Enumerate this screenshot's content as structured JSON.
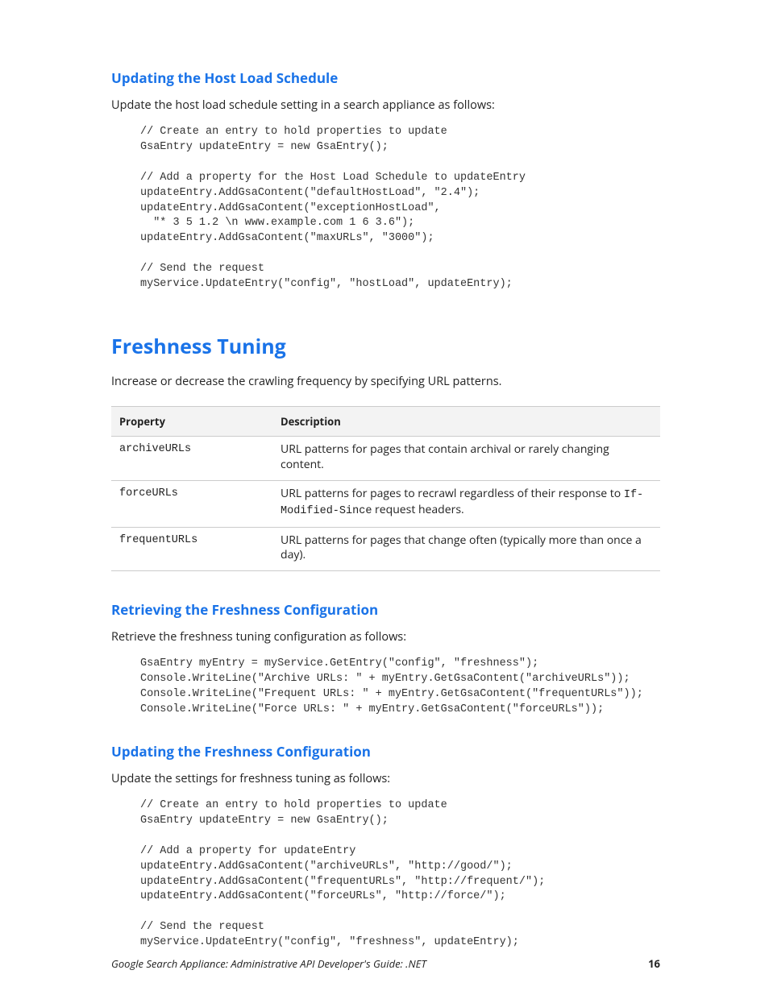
{
  "section1": {
    "heading": "Updating the Host Load Schedule",
    "intro": "Update the host load schedule setting in a search appliance as follows:",
    "code": "// Create an entry to hold properties to update\nGsaEntry updateEntry = new GsaEntry();\n\n// Add a property for the Host Load Schedule to updateEntry\nupdateEntry.AddGsaContent(\"defaultHostLoad\", \"2.4\");\nupdateEntry.AddGsaContent(\"exceptionHostLoad\",\n  \"* 3 5 1.2 \\n www.example.com 1 6 3.6\");\nupdateEntry.AddGsaContent(\"maxURLs\", \"3000\");\n\n// Send the request\nmyService.UpdateEntry(\"config\", \"hostLoad\", updateEntry);"
  },
  "section2": {
    "heading": "Freshness Tuning",
    "intro": "Increase or decrease the crawling frequency by specifying URL patterns.",
    "table": {
      "headers": [
        "Property",
        "Description"
      ],
      "rows": [
        {
          "prop": "archiveURLs",
          "desc_plain": "URL patterns for pages that contain archival or rarely changing content."
        },
        {
          "prop": "forceURLs",
          "desc_prefix": "URL patterns for pages to recrawl regardless of their response to ",
          "desc_code": "If-Modified-Since",
          "desc_suffix": " request headers."
        },
        {
          "prop": "frequentURLs",
          "desc_plain": "URL patterns for pages that change often (typically more than once a day)."
        }
      ]
    }
  },
  "section3": {
    "heading": "Retrieving the Freshness Configuration",
    "intro": "Retrieve the freshness tuning configuration as follows:",
    "code": "GsaEntry myEntry = myService.GetEntry(\"config\", \"freshness\");\nConsole.WriteLine(\"Archive URLs: \" + myEntry.GetGsaContent(\"archiveURLs\"));\nConsole.WriteLine(\"Frequent URLs: \" + myEntry.GetGsaContent(\"frequentURLs\"));\nConsole.WriteLine(\"Force URLs: \" + myEntry.GetGsaContent(\"forceURLs\"));"
  },
  "section4": {
    "heading": "Updating the Freshness Configuration",
    "intro": "Update the settings for freshness tuning as follows:",
    "code": "// Create an entry to hold properties to update\nGsaEntry updateEntry = new GsaEntry();\n\n// Add a property for updateEntry\nupdateEntry.AddGsaContent(\"archiveURLs\", \"http://good/\");\nupdateEntry.AddGsaContent(\"frequentURLs\", \"http://frequent/\");\nupdateEntry.AddGsaContent(\"forceURLs\", \"http://force/\");\n\n// Send the request\nmyService.UpdateEntry(\"config\", \"freshness\", updateEntry);"
  },
  "footer": {
    "title": "Google Search Appliance: Administrative API Developer's Guide: .NET",
    "page": "16"
  }
}
